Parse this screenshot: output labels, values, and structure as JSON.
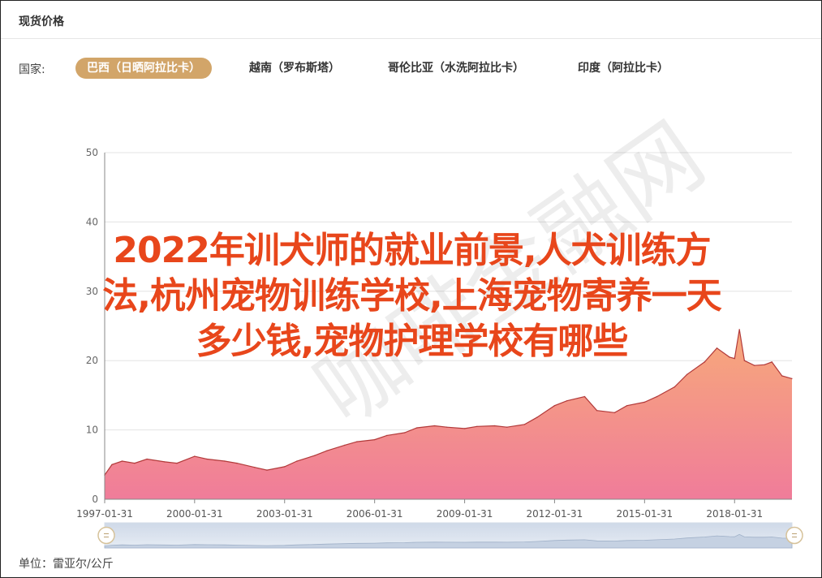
{
  "panel": {
    "title": "现货价格"
  },
  "filter": {
    "label": "国家:",
    "tabs": [
      {
        "label": "巴西（日晒阿拉比卡）",
        "active": true
      },
      {
        "label": "越南（罗布斯塔）",
        "active": false
      },
      {
        "label": "哥伦比亚（水洗阿拉比卡）",
        "active": false
      },
      {
        "label": "印度（阿拉比卡）",
        "active": false
      }
    ]
  },
  "unit_label": "单位：雷亚尔/公斤",
  "overlay": {
    "line1": "2022年训犬师的就业前景,人犬训练方",
    "line2": "法,杭州宠物训练学校,上海宠物寄养一天",
    "line3": "多少钱,宠物护理学校有哪些"
  },
  "watermark": "咖啡金融网",
  "colors": {
    "accent": "#d2a569",
    "area_top": "#f7a97a",
    "area_bottom": "#f07c9a",
    "line": "#b23a3a",
    "overlay_text": "#e8461b"
  },
  "chart_data": {
    "type": "area",
    "ylim": [
      0,
      50
    ],
    "yticks": [
      "0",
      "10",
      "20",
      "30",
      "40",
      "50"
    ],
    "xticks": [
      "1997-01-31",
      "2000-01-31",
      "2003-01-31",
      "2006-01-31",
      "2009-01-31",
      "2012-01-31",
      "2015-01-31",
      "2018-01-31"
    ],
    "xrange": [
      "1997-01-31",
      "2019-12-31"
    ],
    "grid": true,
    "series": [
      {
        "points": [
          [
            "1997-01-31",
            3.5
          ],
          [
            "1997-04-30",
            5.0
          ],
          [
            "1997-08-31",
            5.5
          ],
          [
            "1998-01-31",
            5.2
          ],
          [
            "1998-06-30",
            5.8
          ],
          [
            "1999-01-31",
            5.4
          ],
          [
            "1999-06-30",
            5.2
          ],
          [
            "2000-01-31",
            6.2
          ],
          [
            "2000-06-30",
            5.8
          ],
          [
            "2001-01-31",
            5.5
          ],
          [
            "2001-06-30",
            5.2
          ],
          [
            "2002-01-31",
            4.6
          ],
          [
            "2002-06-30",
            4.2
          ],
          [
            "2003-01-31",
            4.7
          ],
          [
            "2003-06-30",
            5.5
          ],
          [
            "2004-01-31",
            6.3
          ],
          [
            "2004-06-30",
            7.0
          ],
          [
            "2005-01-31",
            7.8
          ],
          [
            "2005-06-30",
            8.3
          ],
          [
            "2006-01-31",
            8.6
          ],
          [
            "2006-06-30",
            9.2
          ],
          [
            "2007-01-31",
            9.6
          ],
          [
            "2007-06-30",
            10.3
          ],
          [
            "2008-01-31",
            10.6
          ],
          [
            "2008-06-30",
            10.4
          ],
          [
            "2009-01-31",
            10.2
          ],
          [
            "2009-06-30",
            10.5
          ],
          [
            "2010-01-31",
            10.6
          ],
          [
            "2010-06-30",
            10.4
          ],
          [
            "2011-01-31",
            10.8
          ],
          [
            "2011-06-30",
            11.8
          ],
          [
            "2012-01-31",
            13.5
          ],
          [
            "2012-06-30",
            14.2
          ],
          [
            "2013-01-31",
            14.8
          ],
          [
            "2013-06-30",
            12.8
          ],
          [
            "2014-01-31",
            12.5
          ],
          [
            "2014-06-30",
            13.5
          ],
          [
            "2015-01-31",
            14.0
          ],
          [
            "2015-06-30",
            14.8
          ],
          [
            "2016-01-31",
            16.2
          ],
          [
            "2016-06-30",
            18.0
          ],
          [
            "2017-01-31",
            19.8
          ],
          [
            "2017-06-30",
            21.8
          ],
          [
            "2017-11-30",
            20.5
          ],
          [
            "2018-01-31",
            20.3
          ],
          [
            "2018-03-31",
            24.5
          ],
          [
            "2018-05-31",
            20.0
          ],
          [
            "2018-09-30",
            19.3
          ],
          [
            "2019-01-31",
            19.4
          ],
          [
            "2019-04-30",
            19.8
          ],
          [
            "2019-08-31",
            17.8
          ],
          [
            "2019-12-31",
            17.4
          ]
        ]
      }
    ]
  }
}
